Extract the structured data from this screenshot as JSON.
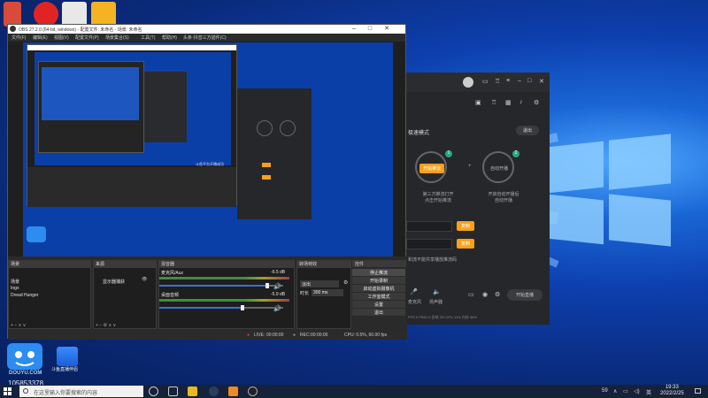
{
  "obs": {
    "title": "OBS 27.2.0 (64-bit, windows) - 配置文件: 未命名 - 场景: 未命名",
    "menu": [
      "文件(F)",
      "编辑(E)",
      "视图(V)",
      "配置文件(P)",
      "场景集合(S)",
      "工具(T)",
      "帮助(H)",
      "头条·抖音三方插件(C)"
    ],
    "preview_status": "斗鱼平台开播成功",
    "docks": {
      "scenes_header": "场景",
      "scene_items": [
        "场景",
        "Ingx",
        "Dread Hunger"
      ],
      "sources_header": "来源",
      "source_items": [
        "显示器捕获"
      ],
      "mixer_header": "混音器",
      "mixer": [
        {
          "name": "麦克风/Aux",
          "level": "-6.5 dB"
        },
        {
          "name": "桌面音频",
          "level": "-5.9 dB"
        }
      ],
      "transitions_header": "转场特效",
      "transition_type": "淡出",
      "duration_label": "时长",
      "duration_value": "300 ms",
      "controls_header": "控件",
      "controls": [
        "停止推流",
        "开始录制",
        "启动虚拟摄像机",
        "工作室模式",
        "设置",
        "退出"
      ]
    },
    "status": {
      "live_label": "LIVE:",
      "live_time": "00:00:00",
      "rec_label": "REC:",
      "rec_time": "00:00:00",
      "cpu": "CPU: 0.5%, 60.00 fps"
    }
  },
  "douyu": {
    "mode_label": "极速模式",
    "exit_button": "退出",
    "start_button": "开始推流",
    "auto_button": "自动开播",
    "step1": "1",
    "step2": "2",
    "desc_left": "第三方推流打开\n点击开始推流",
    "desc_right": "开启自动开播后\n自动开播",
    "copy_button_1": "复制",
    "copy_button_2": "复制",
    "hint": "和流不能共享播放推流码",
    "bottom_button": "开始直播",
    "mic_label": "麦克风",
    "speaker_label": "扬声器",
    "status_row": "FPS 0   PING 0   丢帧 0%   CPU 11%   内存 55%"
  },
  "desktop": {
    "douyu_logo_text": "DOUYU.COM",
    "douyu_number": "105853378",
    "assistant_label": "斗鱼直播伴侣"
  },
  "taskbar": {
    "search_placeholder": "在这里输入你要搜索的内容",
    "tray_num": "59",
    "lang": "英",
    "time": "19:33",
    "date": "2022/2/25"
  }
}
